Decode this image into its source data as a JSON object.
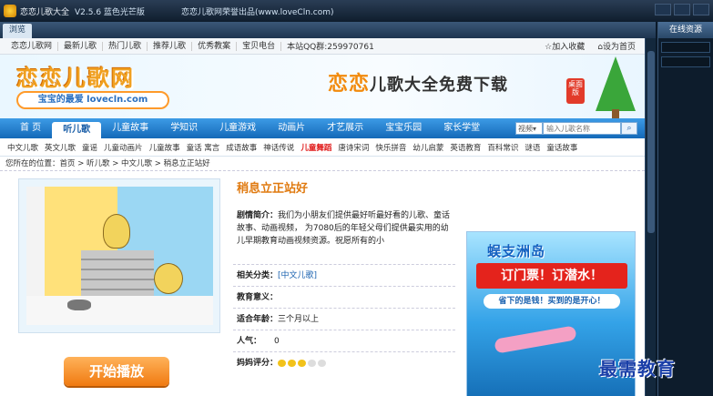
{
  "window": {
    "app_name": "恋恋儿歌大全",
    "version": "V2.5.6 蓝色光芒版",
    "producer": "恋恋儿歌网荣誉出品(www.loveCln.com)"
  },
  "tabbar": {
    "browse_tab": "浏览"
  },
  "right_panel": {
    "title": "在线资源"
  },
  "topnav": {
    "items": [
      "恋恋儿歌网",
      "最新儿歌",
      "热门儿歌",
      "推荐儿歌",
      "优秀教案",
      "宝贝电台"
    ],
    "qq": "本站QQ群:259970761",
    "bookmark": "加入收藏",
    "homepage": "设为首页"
  },
  "banner": {
    "site_logo": "恋恋儿歌网",
    "site_sub": "宝宝的最爱 lovecln.com",
    "slogan_a": "恋恋",
    "slogan_b": "儿歌大全免费下载",
    "badge": "桌面版"
  },
  "mainnav": {
    "items": [
      "首 页",
      "听儿歌",
      "儿童故事",
      "学知识",
      "儿童游戏",
      "动画片",
      "才艺展示",
      "宝宝乐园",
      "家长学堂"
    ],
    "active_index": 1,
    "search_select": "视频",
    "search_placeholder": "输入儿歌名称"
  },
  "subnav": {
    "items": [
      "中文儿歌",
      "英文儿歌",
      "童谣",
      "儿童动画片",
      "儿童故事",
      "童话 寓言",
      "成语故事",
      "神话传说",
      "儿童舞蹈",
      "唐诗宋词",
      "快乐拼音",
      "幼儿启蒙",
      "英语教育",
      "百科常识",
      "谜语",
      "童话故事"
    ],
    "hot_index": 8
  },
  "breadcrumb": "您所在的位置：首页 > 听儿歌 > 中文儿歌 > 稍息立正站好",
  "detail": {
    "title": "稍息立正站好",
    "intro_label": "剧情简介：",
    "intro_text": "我们为小朋友们提供最好听最好看的儿歌、童话故事、动画视频， 为7080后的年轻父母们提供最实用的幼儿早期教育动画视频资源。祝愿所有的小",
    "category_label": "相关分类：",
    "category_value": "[中文儿歌]",
    "meaning_label": "教育意义：",
    "age_label": "适合年龄：",
    "age_value": "三个月以上",
    "popularity_label": "人气：",
    "popularity_value": "0",
    "rating_label": "妈妈评分：",
    "rating": 3,
    "rating_max": 5,
    "play_button": "开始播放"
  },
  "ad": {
    "line1": "蜈支洲岛",
    "line2": "订门票！订潜水！",
    "line3": "省下的是钱！买到的是开心！"
  },
  "watermark": "最需教育",
  "colors": {
    "accent_blue": "#1469b8",
    "accent_orange": "#f07a10",
    "hot_red": "#e01a1a",
    "heart_on": "#f2c21a",
    "heart_off": "#dddddd"
  }
}
